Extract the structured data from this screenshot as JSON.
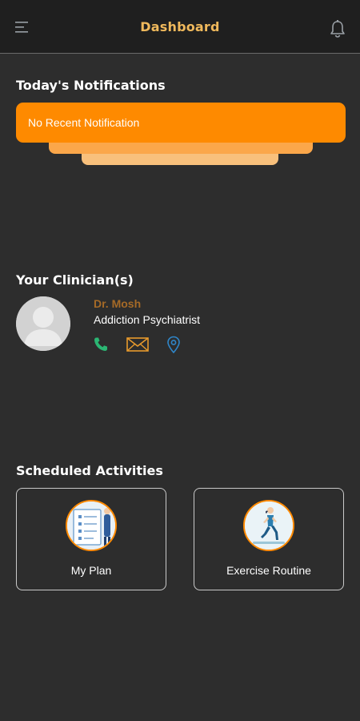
{
  "header": {
    "title": "Dashboard",
    "menu_icon": "menu-icon",
    "bell_icon": "bell-icon"
  },
  "notifications": {
    "section_title": "Today's Notifications",
    "message": "No Recent Notification"
  },
  "clinicians": {
    "section_title": "Your Clinician(s)",
    "items": [
      {
        "name": "Dr. Mosh",
        "role": "Addiction Psychiatrist",
        "actions": [
          "phone-icon",
          "mail-icon",
          "location-pin-icon"
        ]
      }
    ]
  },
  "activities": {
    "section_title": "Scheduled Activities",
    "items": [
      {
        "label": "My Plan",
        "icon": "plan-checklist-icon"
      },
      {
        "label": "Exercise Routine",
        "icon": "running-person-icon"
      }
    ]
  },
  "colors": {
    "background": "#2d2d2d",
    "header_bg": "#1f1f1f",
    "accent": "#fe8a00",
    "title_gold": "#f0b95c",
    "clinician_name": "#a56a27",
    "phone_green": "#2bb673",
    "pin_blue": "#2f86c9"
  }
}
